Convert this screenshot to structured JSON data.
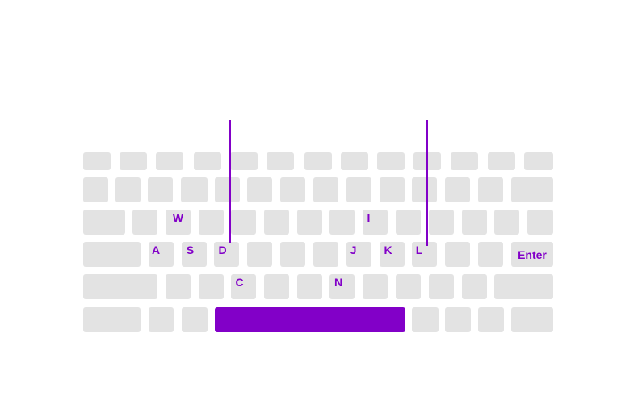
{
  "keyboard": {
    "accent_color": "#8200c8",
    "key_color": "#e3e3e3",
    "highlighted_keys": [
      "W",
      "I",
      "A",
      "S",
      "D",
      "J",
      "K",
      "L",
      "Enter",
      "C",
      "N",
      "Space"
    ],
    "labels": {
      "w": "W",
      "i": "I",
      "a": "A",
      "s": "S",
      "d": "D",
      "j": "J",
      "k": "K",
      "l": "L",
      "enter": "Enter",
      "c": "C",
      "n": "N"
    },
    "markers": [
      "D",
      "L"
    ]
  }
}
